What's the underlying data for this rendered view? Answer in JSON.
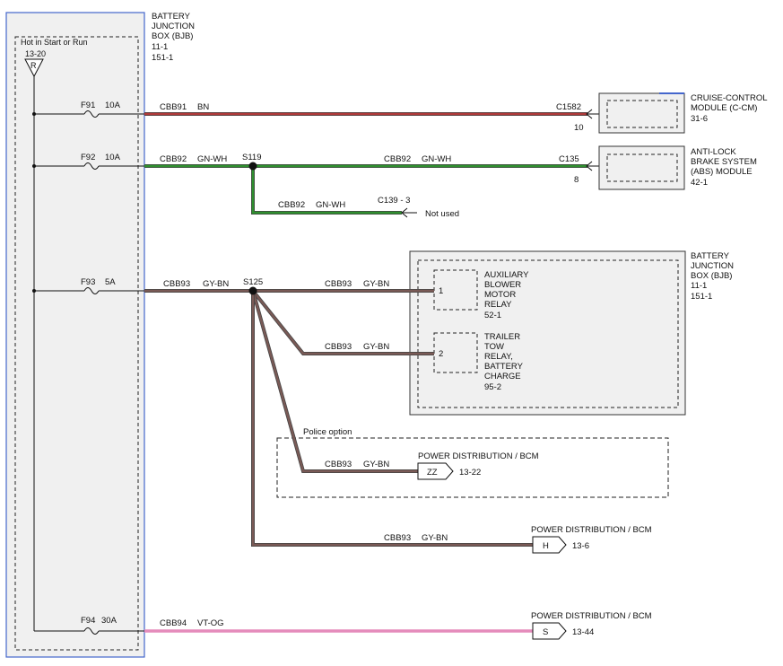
{
  "bjb_left": {
    "title": [
      "BATTERY",
      "JUNCTION",
      "BOX (BJB)",
      "11-1",
      "151-1"
    ],
    "hot_label": "Hot in Start or Run",
    "hot_ref": "13-20",
    "hot_letter": "R"
  },
  "circuits": [
    {
      "fuse": "F91",
      "amps": "10A",
      "wire": "CBB91",
      "color": "BN"
    },
    {
      "fuse": "F92",
      "amps": "10A",
      "wire": "CBB92",
      "color": "GN-WH"
    },
    {
      "fuse": "F93",
      "amps": "5A",
      "wire": "CBB93",
      "color": "GY-BN"
    },
    {
      "fuse": "F94",
      "amps": "30A",
      "wire": "CBB94",
      "color": "VT-OG"
    }
  ],
  "splices": {
    "s119": "S119",
    "s125": "S125"
  },
  "branches": {
    "cbb92_right": {
      "wire": "CBB92",
      "color": "GN-WH"
    },
    "cbb92_down": {
      "wire": "CBB92",
      "color": "GN-WH"
    },
    "c139": "C139 - 3",
    "not_used": "Not used",
    "relay1": {
      "wire": "CBB93",
      "color": "GY-BN"
    },
    "relay2": {
      "wire": "CBB93",
      "color": "GY-BN"
    },
    "police": {
      "wire": "CBB93",
      "color": "GY-BN"
    },
    "bottom": {
      "wire": "CBB93",
      "color": "GY-BN"
    }
  },
  "connectors": {
    "c1582": "C1582",
    "c1582_pin": "10",
    "c135": "C135",
    "c135_pin": "8"
  },
  "modules": {
    "ccm": [
      "CRUISE-CONTROL",
      "MODULE (C-CM)",
      "31-6"
    ],
    "abs": [
      "ANTI-LOCK",
      "BRAKE SYSTEM",
      "(ABS) MODULE",
      "42-1"
    ],
    "bjb_right": [
      "BATTERY",
      "JUNCTION",
      "BOX (BJB)",
      "11-1",
      "151-1"
    ],
    "relay1": {
      "pin": "1",
      "lines": [
        "AUXILIARY",
        "BLOWER",
        "MOTOR",
        "RELAY",
        "52-1"
      ]
    },
    "relay2": {
      "pin": "2",
      "lines": [
        "TRAILER",
        "TOW",
        "RELAY,",
        "BATTERY",
        "CHARGE",
        "95-2"
      ]
    }
  },
  "police_option": "Police option",
  "destinations": [
    {
      "title": "POWER DISTRIBUTION / BCM",
      "letter": "ZZ",
      "ref": "13-22"
    },
    {
      "title": "POWER DISTRIBUTION / BCM",
      "letter": "H",
      "ref": "13-6"
    },
    {
      "title": "POWER DISTRIBUTION / BCM",
      "letter": "S",
      "ref": "13-44"
    }
  ],
  "wire_colors": {
    "BN": "#b03a3a",
    "GN-WH": "#2f8f2f",
    "GY-BN": "#7a5a56",
    "VT-OG": "#e58bbb"
  }
}
